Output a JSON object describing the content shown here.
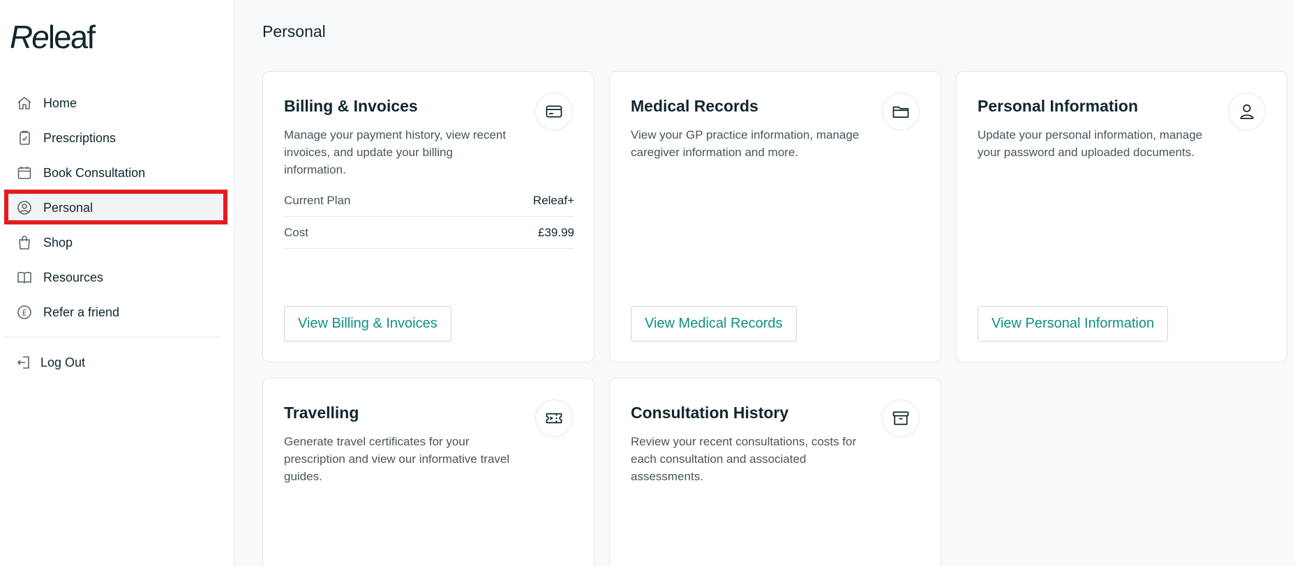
{
  "logo": {
    "part1": "Re",
    "part2": "leaf"
  },
  "sidebar": {
    "items": [
      {
        "label": "Home",
        "icon": "home-icon"
      },
      {
        "label": "Prescriptions",
        "icon": "prescription-icon"
      },
      {
        "label": "Book Consultation",
        "icon": "calendar-icon"
      },
      {
        "label": "Personal",
        "icon": "user-circle-icon"
      },
      {
        "label": "Shop",
        "icon": "shopping-bag-icon"
      },
      {
        "label": "Resources",
        "icon": "book-icon"
      },
      {
        "label": "Refer a friend",
        "icon": "pound-coin-icon"
      }
    ],
    "logout": {
      "label": "Log Out",
      "icon": "logout-icon"
    }
  },
  "main": {
    "title": "Personal",
    "cards": {
      "billing": {
        "title": "Billing & Invoices",
        "description": "Manage your payment history, view recent invoices, and update your billing information.",
        "icon": "credit-card-icon",
        "rows": [
          {
            "label": "Current Plan",
            "value": "Releaf+"
          },
          {
            "label": "Cost",
            "value": "£39.99"
          }
        ],
        "button": "View Billing & Invoices"
      },
      "medical": {
        "title": "Medical Records",
        "description": "View your GP practice information, manage caregiver information and more.",
        "icon": "folder-icon",
        "button": "View Medical Records"
      },
      "personal_info": {
        "title": "Personal Information",
        "description": "Update your personal information, manage your password and uploaded documents.",
        "icon": "user-icon",
        "button": "View Personal Information"
      },
      "travelling": {
        "title": "Travelling",
        "description": "Generate travel certificates for your prescription and view our informative travel guides.",
        "icon": "ticket-icon"
      },
      "consultation_history": {
        "title": "Consultation History",
        "description": "Review your recent consultations, costs for each consultation and associated assessments.",
        "icon": "archive-box-icon"
      }
    }
  },
  "colors": {
    "accent": "#0e8f84",
    "highlight": "#e31c1c",
    "text": "#10262c"
  }
}
